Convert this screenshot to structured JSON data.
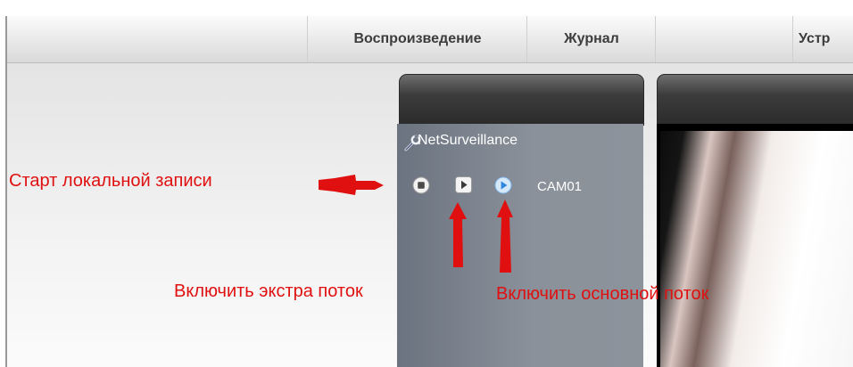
{
  "menu": {
    "playback": "Воспроизведение",
    "log": "Журнал",
    "devices": "Устр"
  },
  "device_tree": {
    "device_name": "NetSurveillance",
    "device_icon": "wrench-icon",
    "channel": {
      "name": "CAM01",
      "controls": [
        {
          "name": "record-toggle",
          "icon": "stop-circle-icon"
        },
        {
          "name": "extra-stream",
          "icon": "play-square-icon"
        },
        {
          "name": "main-stream",
          "icon": "play-circle-blue-icon"
        }
      ]
    }
  },
  "annotations": {
    "start_local_record": "Старт локальной записи",
    "enable_extra_stream": "Включить экстра поток",
    "enable_main_stream": "Включить основной поток"
  },
  "colors": {
    "annotation": "#e01010",
    "panel": "#7d848d",
    "main_stream_icon": "#3a8ee6"
  }
}
